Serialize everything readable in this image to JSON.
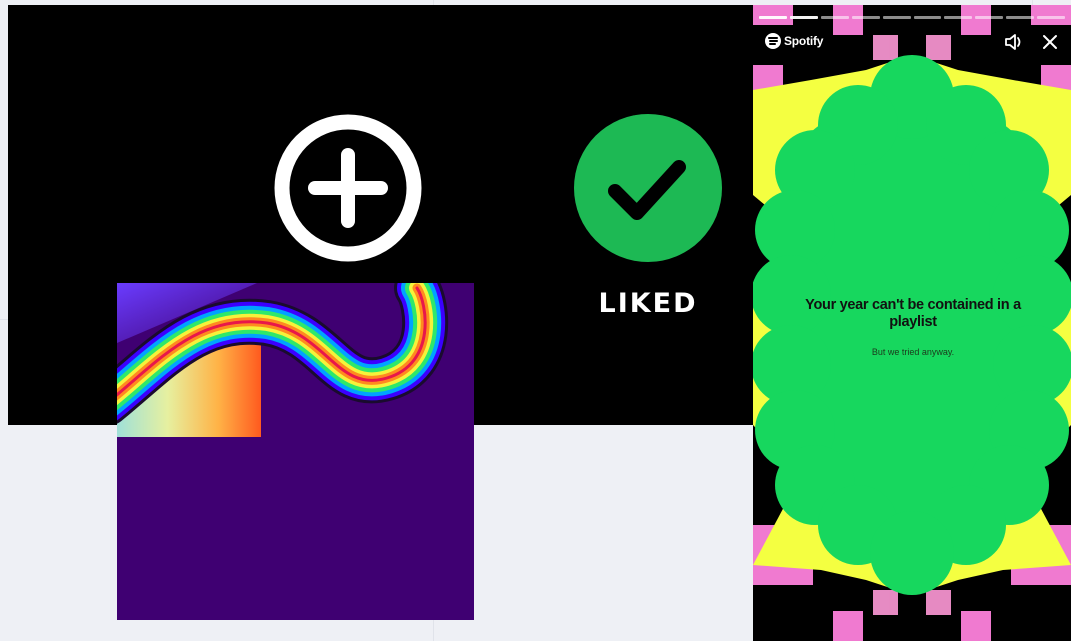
{
  "like_panel": {
    "add_icon": "plus-circle-icon",
    "liked_icon": "check-circle-icon",
    "liked_label": "LIKED",
    "colors": {
      "background": "#000000",
      "green": "#1db954",
      "white": "#ffffff"
    }
  },
  "album_art": {
    "colors": {
      "background": "#3f0072"
    }
  },
  "story": {
    "brand": "Spotify",
    "title": "Your year can't be contained in a playlist",
    "subtitle": "But we tried anyway.",
    "progress_segments_done": 2,
    "progress_segments_total": 10,
    "icons": [
      "spotify-logo-icon",
      "volume-icon",
      "close-icon"
    ],
    "colors": {
      "green": "#17d75e",
      "yellow": "#f4ff41",
      "pink": "#f07ad0",
      "black": "#000000"
    }
  }
}
